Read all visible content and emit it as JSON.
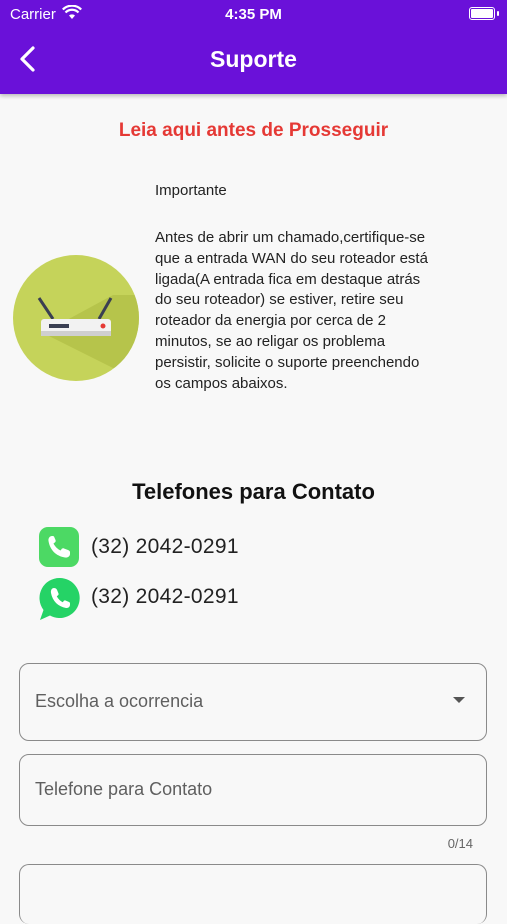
{
  "status_bar": {
    "carrier": "Carrier",
    "time": "4:35 PM"
  },
  "header": {
    "title": "Suporte",
    "back_icon": "chevron-left-icon"
  },
  "notice": {
    "heading": "Leia aqui antes de Prosseguir",
    "heading_color": "#e53935",
    "important_title": "Importante",
    "body_lines": [
      "Antes de abrir um chamado,certifique-se",
      "que a entrada WAN do seu roteador está",
      "ligada(A entrada fica em destaque atrás",
      "do seu roteador) se estiver, retire seu",
      "roteador da energia por cerca de 2",
      "minutos, se ao religar os problema",
      "persistir, solicite o suporte preenchendo",
      "os campos abaixos."
    ],
    "image_icon": "router-icon"
  },
  "contacts": {
    "title": "Telefones para Contato",
    "phones": [
      {
        "icon": "phone-icon",
        "number": "(32) 2042-0291"
      },
      {
        "icon": "whatsapp-icon",
        "number": "(32) 2042-0291"
      }
    ]
  },
  "form": {
    "occurrence_placeholder": "Escolha a ocorrencia",
    "phone_placeholder": "Telefone para Contato",
    "phone_counter": "0/14"
  },
  "colors": {
    "app_bar": "#6a11d9",
    "phone_green": "#4cd964",
    "whatsapp_green": "#25d366"
  }
}
